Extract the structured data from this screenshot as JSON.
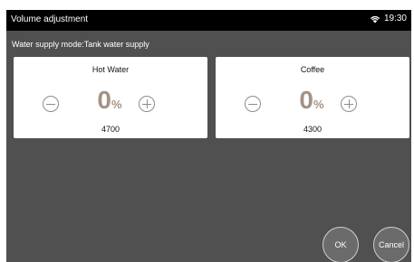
{
  "window": {
    "title": "Volume adjustment"
  },
  "status_bar": {
    "time": "19:30",
    "wifi_icon": "wifi-icon"
  },
  "subheader": {
    "text": "Water supply mode:Tank water supply"
  },
  "cards": [
    {
      "title": "Hot Water",
      "percent": "0",
      "percent_unit": "%",
      "value": "4700"
    },
    {
      "title": "Coffee",
      "percent": "0",
      "percent_unit": "%",
      "value": "4300"
    }
  ],
  "buttons": {
    "ok": "OK",
    "cancel": "Cancel"
  },
  "colors": {
    "bg": "#505050",
    "statusbar": "#000000",
    "card": "#ffffff",
    "percent": "#a49286",
    "icon": "#8d8d8d"
  }
}
